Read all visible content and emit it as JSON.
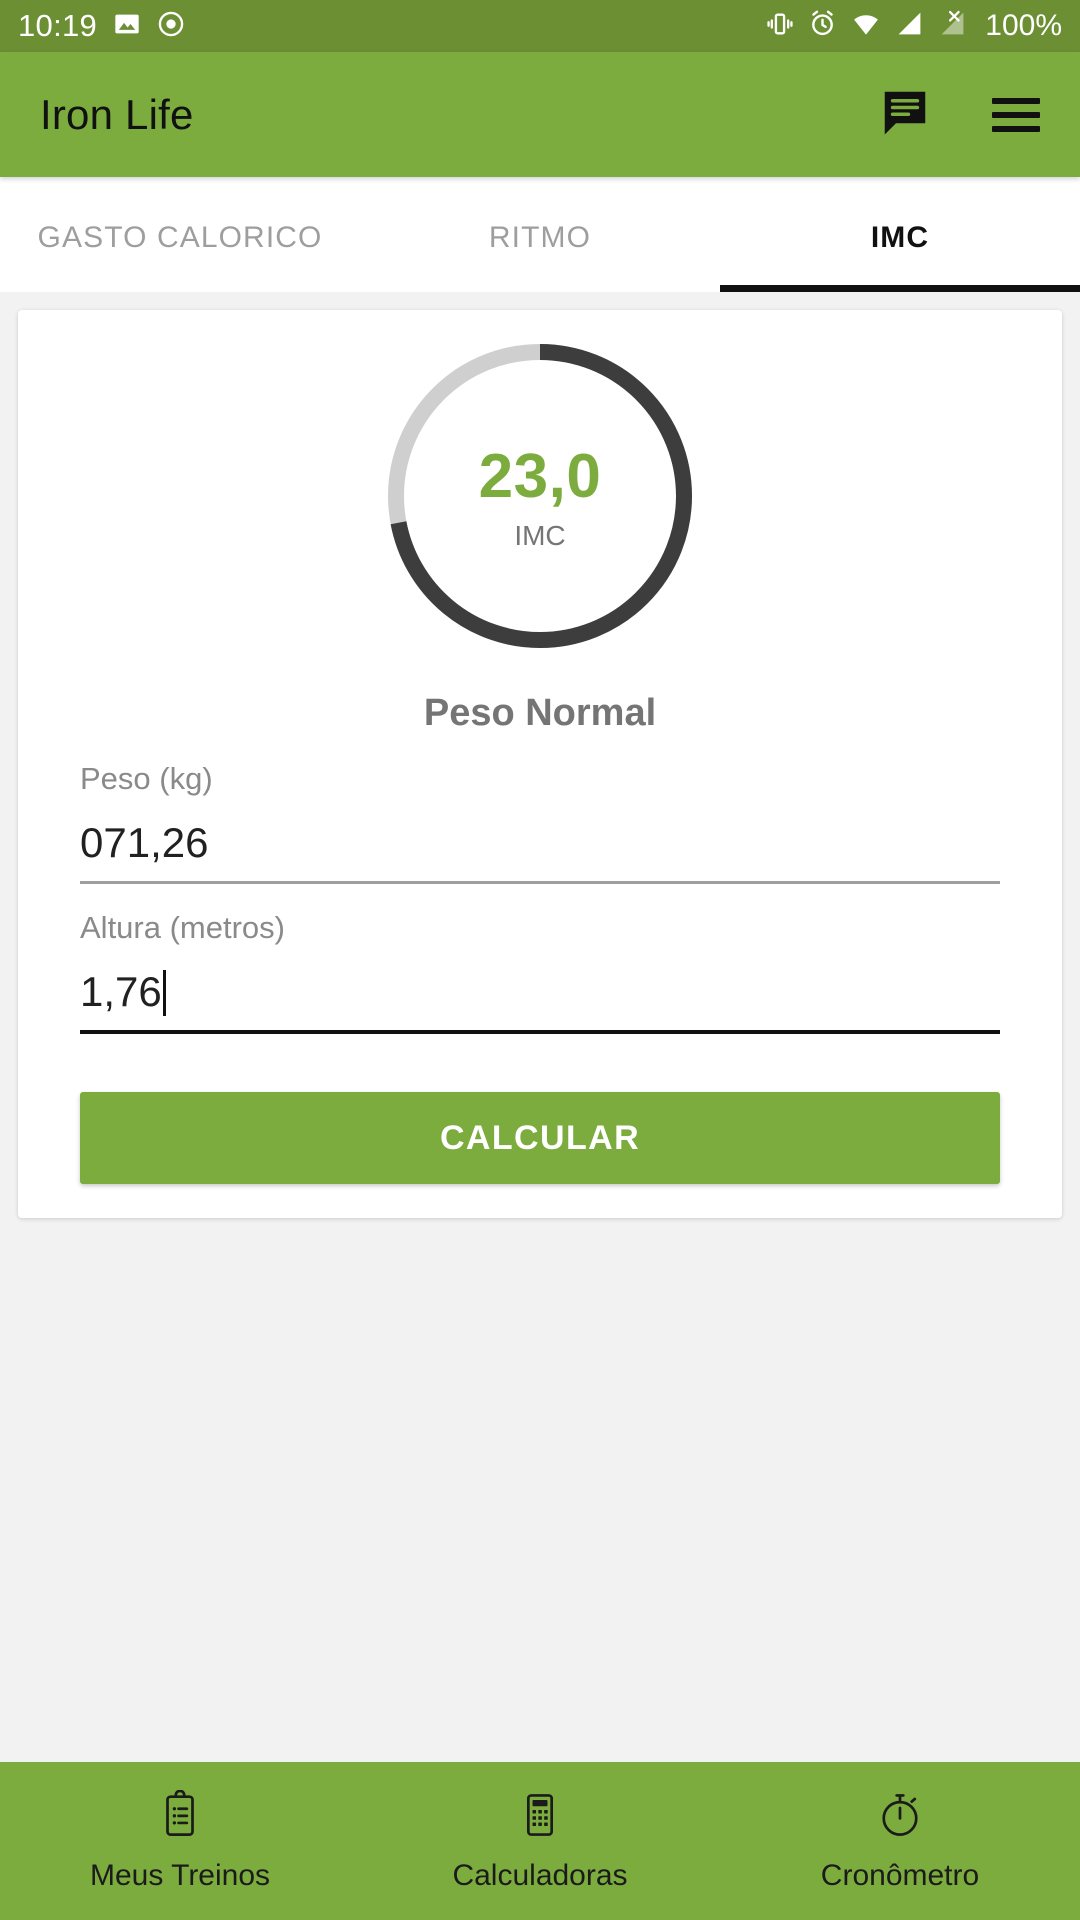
{
  "status_bar": {
    "time": "10:19",
    "battery": "100%",
    "icons": [
      "image-icon",
      "record-icon",
      "vibrate-icon",
      "alarm-icon",
      "wifi-icon",
      "signal-icon",
      "signal-off-icon"
    ],
    "background": "#6d8f33"
  },
  "app_bar": {
    "title": "Iron Life",
    "background": "#7cac3e",
    "actions": [
      "chat-icon",
      "menu-icon"
    ]
  },
  "tabs": [
    {
      "label": "GASTO CALORICO",
      "active": false
    },
    {
      "label": "RITMO",
      "active": false
    },
    {
      "label": "IMC",
      "active": true
    }
  ],
  "gauge": {
    "value": "23,0",
    "unit_label": "IMC",
    "progress_percent": 72,
    "track_color": "#cfcfcf",
    "progress_color": "#3d3d3d",
    "value_color": "#7cac3e"
  },
  "classification": "Peso Normal",
  "form": {
    "fields": [
      {
        "label": "Peso (kg)",
        "value": "071,26",
        "placeholder": "Peso (kg)",
        "focused": false
      },
      {
        "label": "Altura (metros)",
        "value": "1,76",
        "placeholder": "Altura (metros)",
        "focused": true
      }
    ],
    "submit_label": "CALCULAR",
    "submit_color": "#7cac3e"
  },
  "bottom_nav": {
    "background": "#7cac3e",
    "items": [
      {
        "label": "Meus Treinos",
        "icon": "clipboard-icon"
      },
      {
        "label": "Calculadoras",
        "icon": "calculator-icon"
      },
      {
        "label": "Cronômetro",
        "icon": "stopwatch-icon"
      }
    ]
  }
}
